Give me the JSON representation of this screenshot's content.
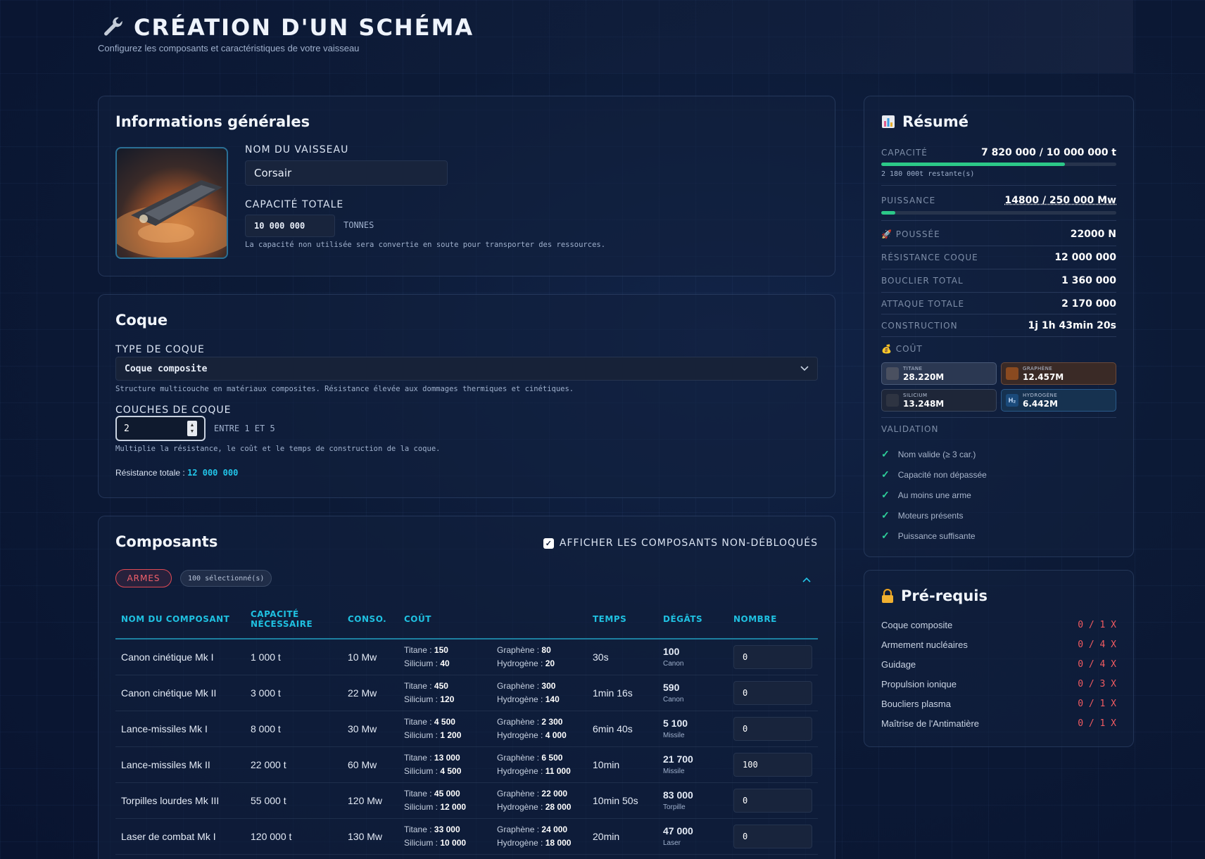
{
  "header": {
    "title": "CRÉATION D'UN SCHÉMA",
    "subtitle": "Configurez les composants et caractéristiques de votre vaisseau"
  },
  "info": {
    "title": "Informations générales",
    "ship_name_label": "NOM DU VAISSEAU",
    "ship_name_value": "Corsair",
    "capacity_label": "CAPACITÉ TOTALE",
    "capacity_value": "10 000 000",
    "capacity_unit": "TONNES",
    "capacity_note": "La capacité non utilisée sera convertie en soute pour transporter des ressources."
  },
  "coque": {
    "title": "Coque",
    "type_label": "TYPE DE COQUE",
    "type_value": "Coque composite",
    "type_desc": "Structure multicouche en matériaux composites. Résistance élevée aux dommages thermiques et cinétiques.",
    "layers_label": "COUCHES DE COQUE",
    "layers_value": "2",
    "layers_range": "ENTRE 1 ET 5",
    "layers_desc": "Multiplie la résistance, le coût et le temps de construction de la coque.",
    "resistance_label": "Résistance totale :",
    "resistance_value": "12 000 000"
  },
  "composants": {
    "title": "Composants",
    "show_locked_label": "AFFICHER LES COMPOSANTS NON-DÉBLOQUÉS",
    "category": "ARMES",
    "selected_count": "100 sélectionné(s)",
    "headers": [
      "NOM DU COMPOSANT",
      "CAPACITÉ NÉCESSAIRE",
      "CONSO.",
      "COÛT",
      "",
      "TEMPS",
      "DÉGÂTS",
      "NOMBRE"
    ],
    "rows": [
      {
        "name": "Canon cinétique Mk I",
        "capacity": "1 000 t",
        "conso": "10 Mw",
        "titane": "150",
        "silicium": "40",
        "graphene": "80",
        "hydrogene": "20",
        "time": "30s",
        "damage": "100",
        "damage_type": "Canon",
        "count": "0"
      },
      {
        "name": "Canon cinétique Mk II",
        "capacity": "3 000 t",
        "conso": "22 Mw",
        "titane": "450",
        "silicium": "120",
        "graphene": "300",
        "hydrogene": "140",
        "time": "1min 16s",
        "damage": "590",
        "damage_type": "Canon",
        "count": "0"
      },
      {
        "name": "Lance-missiles Mk I",
        "capacity": "8 000 t",
        "conso": "30 Mw",
        "titane": "4 500",
        "silicium": "1 200",
        "graphene": "2 300",
        "hydrogene": "4 000",
        "time": "6min 40s",
        "damage": "5 100",
        "damage_type": "Missile",
        "count": "0"
      },
      {
        "name": "Lance-missiles Mk II",
        "capacity": "22 000 t",
        "conso": "60 Mw",
        "titane": "13 000",
        "silicium": "4 500",
        "graphene": "6 500",
        "hydrogene": "11 000",
        "time": "10min",
        "damage": "21 700",
        "damage_type": "Missile",
        "count": "100"
      },
      {
        "name": "Torpilles lourdes Mk III",
        "capacity": "55 000 t",
        "conso": "120 Mw",
        "titane": "45 000",
        "silicium": "12 000",
        "graphene": "22 000",
        "hydrogene": "28 000",
        "time": "10min 50s",
        "damage": "83 000",
        "damage_type": "Torpille",
        "count": "0"
      },
      {
        "name": "Laser de combat Mk I",
        "capacity": "120 000 t",
        "conso": "130 Mw",
        "titane": "33 000",
        "silicium": "10 000",
        "graphene": "24 000",
        "hydrogene": "18 000",
        "time": "20min",
        "damage": "47 000",
        "damage_type": "Laser",
        "count": "0"
      }
    ],
    "cost_labels": {
      "titane": "Titane :",
      "silicium": "Silicium :",
      "graphene": "Graphène :",
      "hydrogene": "Hydrogène :"
    }
  },
  "resume": {
    "title": "Résumé",
    "capacity_label": "CAPACITÉ",
    "capacity_value": "7 820 000 / 10 000 000 t",
    "capacity_fraction": 0.782,
    "capacity_remaining": "2 180 000t restante(s)",
    "power_label": "PUISSANCE",
    "power_value": "14800 / 250 000 Mw",
    "power_fraction": 0.059,
    "thrust_label": "POUSSÉE",
    "thrust_value": "22000 N",
    "hull_label": "RÉSISTANCE COQUE",
    "hull_value": "12 000 000",
    "shield_label": "BOUCLIER TOTAL",
    "shield_value": "1 360 000",
    "attack_label": "ATTAQUE TOTALE",
    "attack_value": "2 170 000",
    "construction_label": "CONSTRUCTION",
    "construction_value": "1j 1h 43min 20s",
    "cost_label": "COÛT",
    "costs": [
      {
        "name": "TITANE",
        "value": "28.220M",
        "color": "#2b3852"
      },
      {
        "name": "GRAPHÈNE",
        "value": "12.457M",
        "color": "#3a2a26"
      },
      {
        "name": "SILICIUM",
        "value": "13.248M",
        "color": "#1e2638"
      },
      {
        "name": "HYDROGÈNE",
        "value": "6.442M",
        "color": "#163250"
      }
    ],
    "validation_label": "VALIDATION",
    "validations": [
      "Nom valide (≥ 3 car.)",
      "Capacité non dépassée",
      "Au moins une arme",
      "Moteurs présents",
      "Puissance suffisante"
    ]
  },
  "prerequis": {
    "title": "Pré-requis",
    "items": [
      {
        "name": "Coque composite",
        "value": "0 / 1 X"
      },
      {
        "name": "Armement nucléaires",
        "value": "0 / 4 X"
      },
      {
        "name": "Guidage",
        "value": "0 / 4 X"
      },
      {
        "name": "Propulsion ionique",
        "value": "0 / 3 X"
      },
      {
        "name": "Boucliers plasma",
        "value": "0 / 1 X"
      },
      {
        "name": "Maîtrise de l'Antimatière",
        "value": "0 / 1 X"
      }
    ]
  }
}
